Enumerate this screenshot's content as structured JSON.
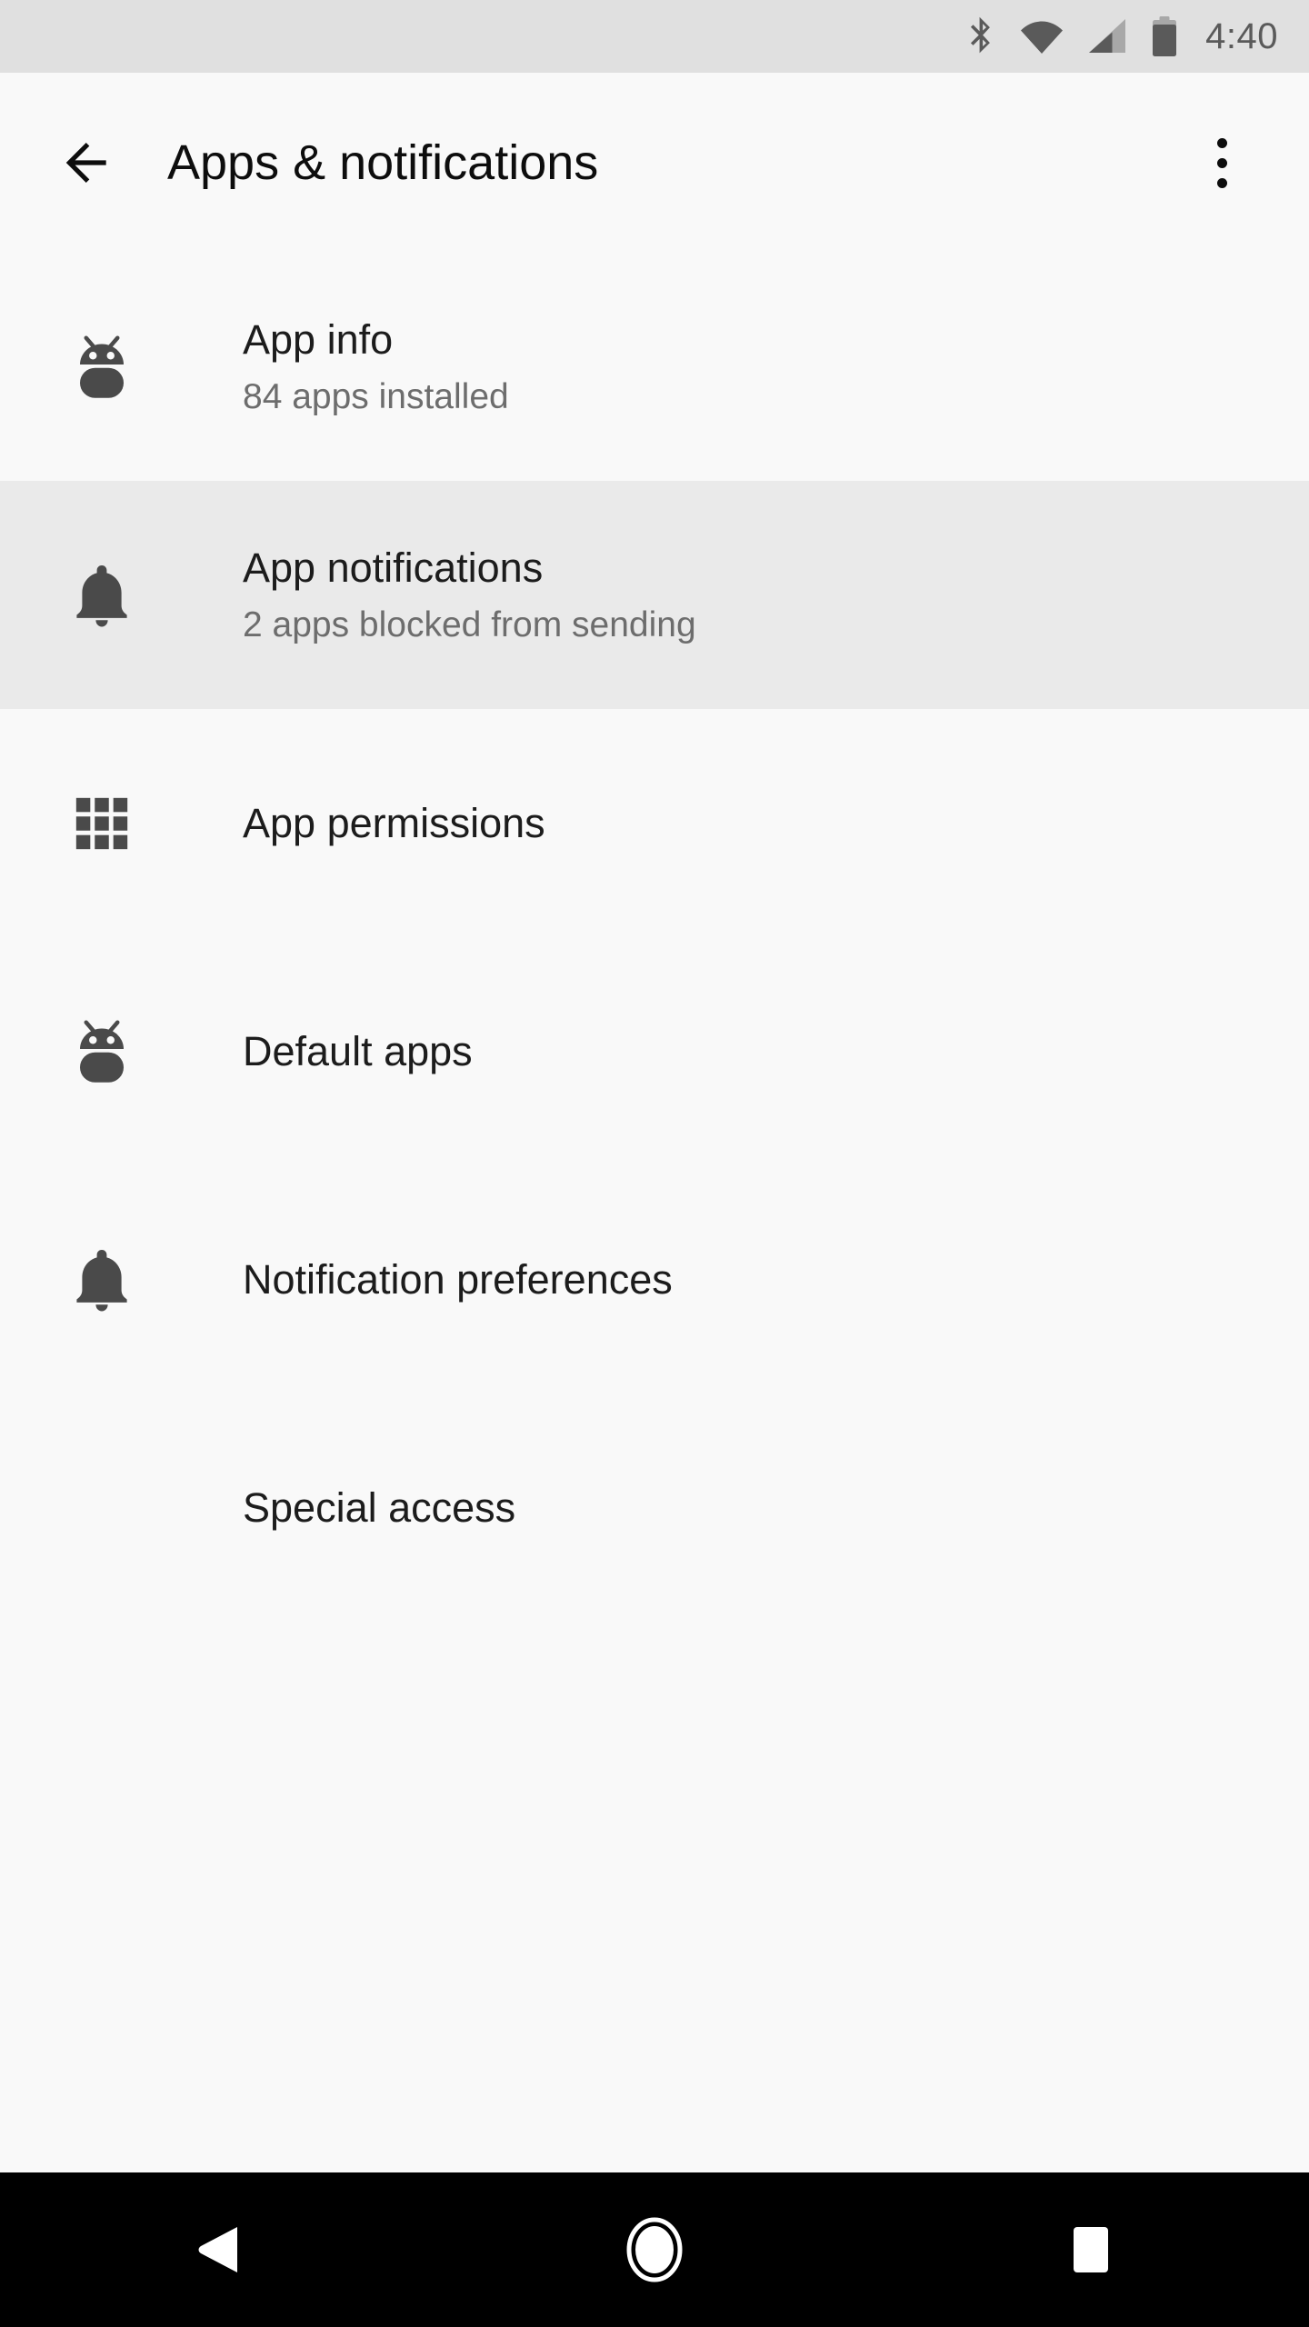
{
  "status_bar": {
    "time": "4:40",
    "icons": [
      "bluetooth-icon",
      "wifi-icon",
      "cellular-signal-icon",
      "battery-icon"
    ],
    "background_color": "#e0e0e0",
    "foreground_color": "#5a5a5a"
  },
  "app_bar": {
    "back_icon": "arrow-back-icon",
    "title": "Apps & notifications",
    "overflow_icon": "more-vert-icon",
    "background_color": "#f9f9f9",
    "title_color": "#0d0d0d"
  },
  "list": {
    "selected_row_color": "#eaeaea",
    "items": [
      {
        "icon": "android-bug-icon",
        "title": "App info",
        "subtitle": "84 apps installed",
        "selected": false
      },
      {
        "icon": "bell-icon",
        "title": "App notifications",
        "subtitle": "2 apps blocked from sending",
        "selected": true
      },
      {
        "icon": "grid-3x3-icon",
        "title": "App permissions",
        "subtitle": "",
        "selected": false
      },
      {
        "icon": "android-bug-icon",
        "title": "Default apps",
        "subtitle": "",
        "selected": false
      },
      {
        "icon": "bell-icon",
        "title": "Notification preferences",
        "subtitle": "",
        "selected": false
      },
      {
        "icon": "",
        "title": "Special access",
        "subtitle": "",
        "selected": false
      }
    ]
  },
  "nav_bar": {
    "background_color": "#000000",
    "buttons": [
      {
        "name": "back-nav-button",
        "icon": "triangle-back-icon"
      },
      {
        "name": "home-nav-button",
        "icon": "circle-home-icon"
      },
      {
        "name": "recents-nav-button",
        "icon": "square-recents-icon"
      }
    ]
  }
}
